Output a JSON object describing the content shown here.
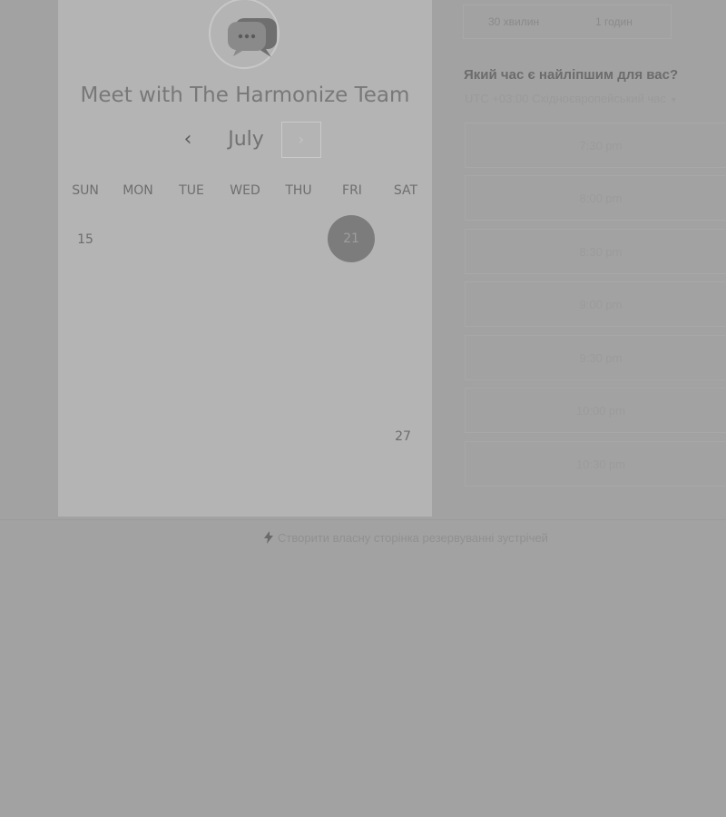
{
  "header": {
    "title": "Meet with The Harmonize Team",
    "avatar_icon": "chat-bubble-icon"
  },
  "calendar": {
    "month": "July",
    "prev_icon": "‹",
    "next_icon": "›",
    "weekdays": [
      "SUN",
      "MON",
      "TUE",
      "WED",
      "THU",
      "FRI",
      "SAT"
    ],
    "days": [
      {
        "label": "15",
        "selected": false
      },
      {
        "label": "21",
        "selected": true
      },
      {
        "label": "27",
        "selected": false
      }
    ]
  },
  "durations": [
    "30 хвилин",
    "1 годин"
  ],
  "time_question": "Який час є найліпшим для вас?",
  "timezone": "UTC +03:00 Східноєвропейський час",
  "timezone_caret": "▼",
  "slots": [
    "7:30 pm",
    "8:00 pm",
    "8:30 pm",
    "9:00 pm",
    "9:30 pm",
    "10:00 pm",
    "10:30 pm"
  ],
  "footer": {
    "link_icon": "bolt-icon",
    "link_label": "Створити власну сторінка резервуванні зустрічей"
  }
}
